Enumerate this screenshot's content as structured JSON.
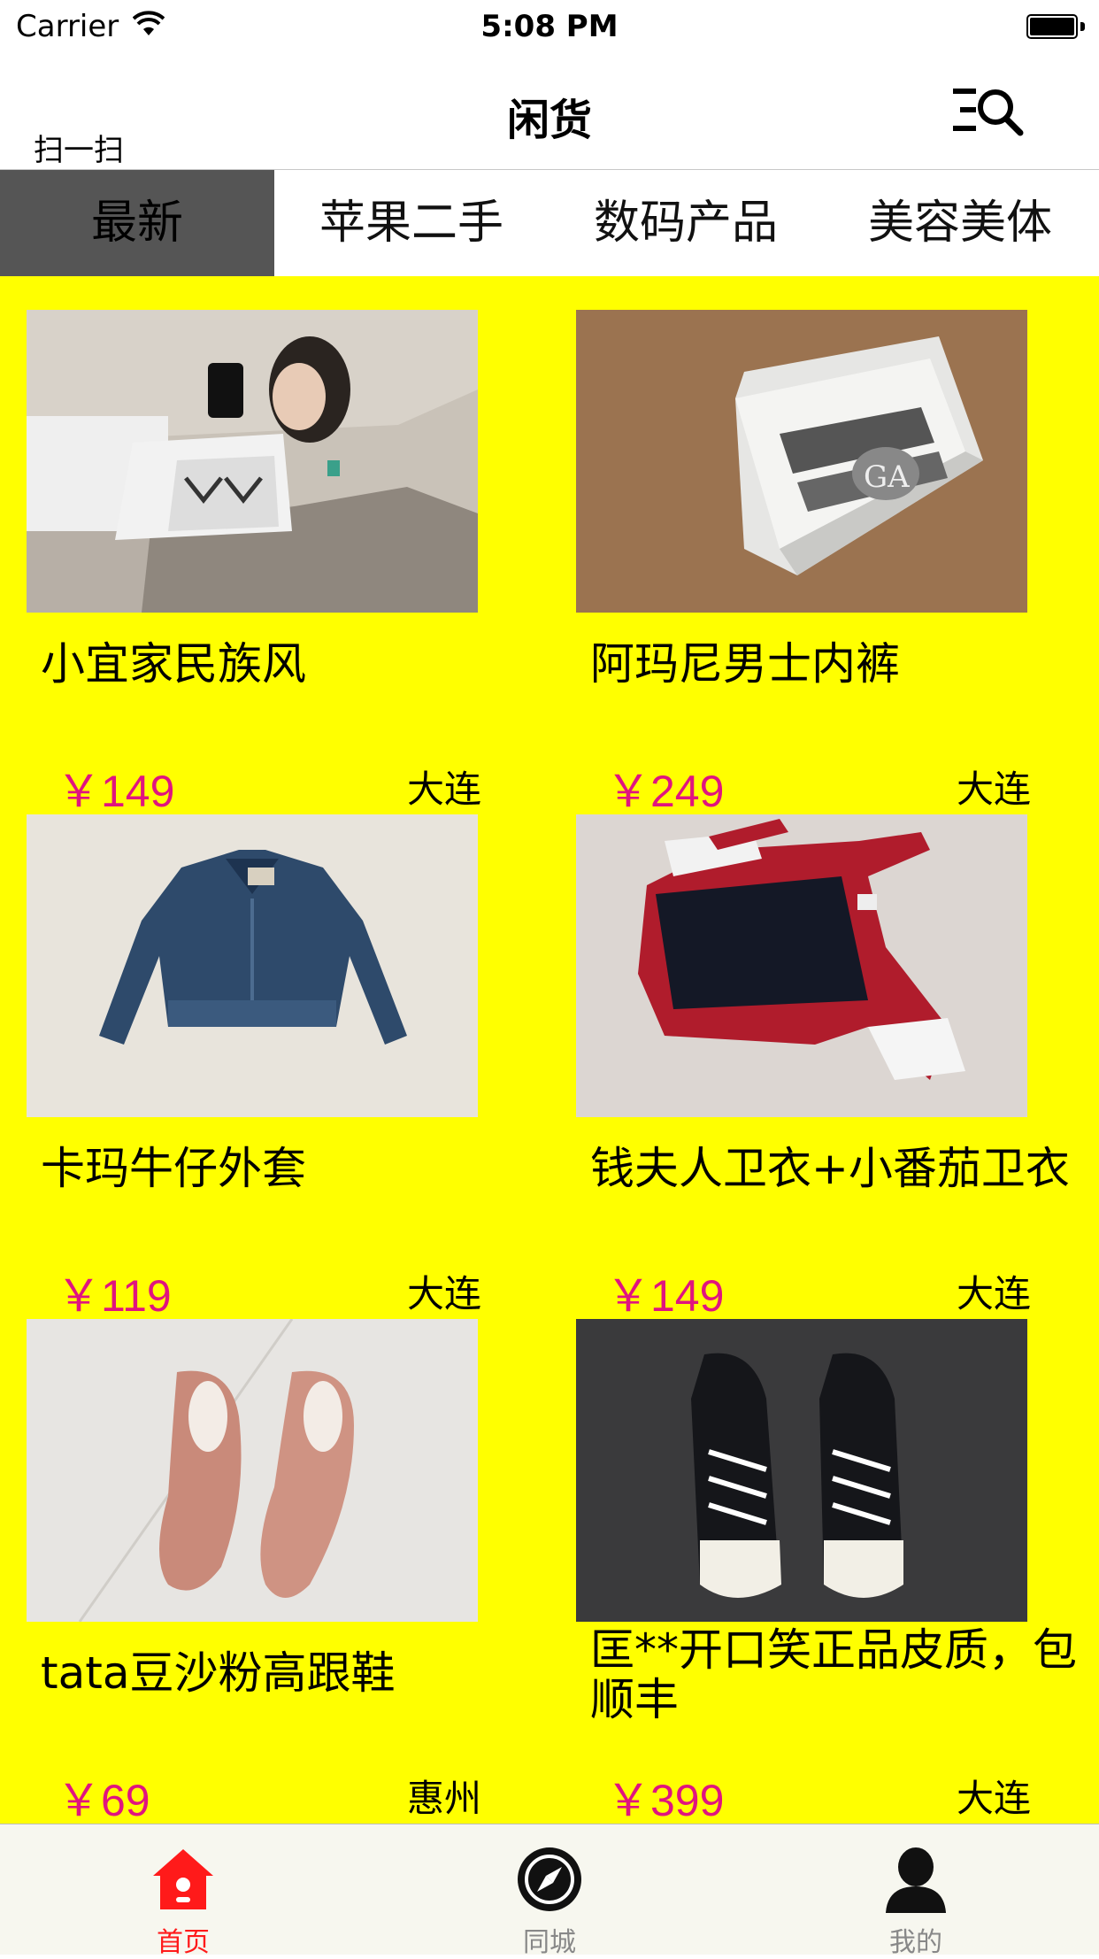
{
  "status_bar": {
    "carrier": "Carrier",
    "time": "5:08 PM"
  },
  "nav": {
    "title": "闲货",
    "scan_label": "扫一扫",
    "search_menu_icon": "search-list-icon"
  },
  "tabs": [
    {
      "label": "最新",
      "active": true
    },
    {
      "label": "苹果二手",
      "active": false
    },
    {
      "label": "数码产品",
      "active": false
    },
    {
      "label": "美容美体",
      "active": false
    }
  ],
  "products": [
    {
      "name": "小宜家民族风",
      "price": "￥149",
      "city": "大连",
      "image": "selfie-photo"
    },
    {
      "name": "阿玛尼男士内裤",
      "price": "￥249",
      "city": "大连",
      "image": "armani-box-photo"
    },
    {
      "name": "卡玛牛仔外套",
      "price": "￥119",
      "city": "大连",
      "image": "denim-jacket-photo"
    },
    {
      "name": "钱夫人卫衣+小番茄卫衣",
      "price": "￥149",
      "city": "大连",
      "image": "sweater-photo"
    },
    {
      "name": "tata豆沙粉高跟鞋",
      "price": "￥69",
      "city": "惠州",
      "image": "pink-heels-photo"
    },
    {
      "name": "匡**开口笑正品皮质，包顺丰",
      "price": "￥399",
      "city": "大连",
      "image": "sneakers-photo"
    }
  ],
  "tabbar": [
    {
      "label": "首页",
      "icon": "home-icon",
      "active": true
    },
    {
      "label": "同城",
      "icon": "compass-icon",
      "active": false
    },
    {
      "label": "我的",
      "icon": "user-icon",
      "active": false
    }
  ],
  "colors": {
    "grid_background": "#ffff00",
    "price": "#e0147f",
    "active_tab": "#555555",
    "tabbar_active": "#ff1a1a"
  }
}
